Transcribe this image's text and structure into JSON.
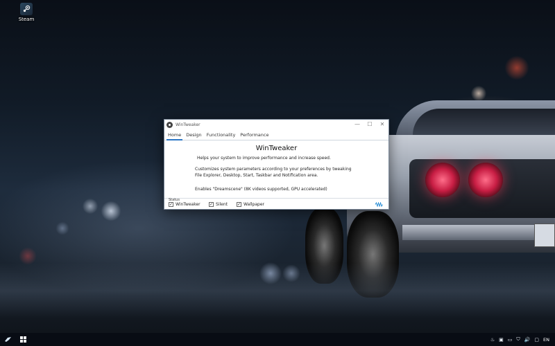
{
  "desktop": {
    "icons": [
      {
        "label": "Steam",
        "icon": "steam-icon"
      }
    ]
  },
  "window": {
    "title": "WinTweaker",
    "controls": {
      "minimize": "—",
      "maximize": "☐",
      "close": "✕"
    },
    "tabs": [
      {
        "label": "Home",
        "active": true
      },
      {
        "label": "Design",
        "active": false
      },
      {
        "label": "Functionality",
        "active": false
      },
      {
        "label": "Performance",
        "active": false
      }
    ],
    "content": {
      "heading": "WinTweaker",
      "tagline": "Helps your system to improve performance and increase speed.",
      "description_line1": "Customizes system parameters according to your preferences by tweaking",
      "description_line2": "File Explorer, Desktop, Start, Taskbar and Notification area.",
      "feature": "Enables \"Dreamscene\" (8K videos supported, GPU accelerated)"
    },
    "status": {
      "label": "Status",
      "checks": [
        {
          "label": "WinTweaker",
          "checked": true
        },
        {
          "label": "Silent",
          "checked": true
        },
        {
          "label": "Wallpaper",
          "checked": true
        }
      ],
      "indicator_icon": "signal-wave-icon",
      "accent_color": "#2b77c6"
    }
  },
  "taskbar": {
    "start_icon": "windows-logo-icon",
    "tray": {
      "language": "EN"
    }
  }
}
